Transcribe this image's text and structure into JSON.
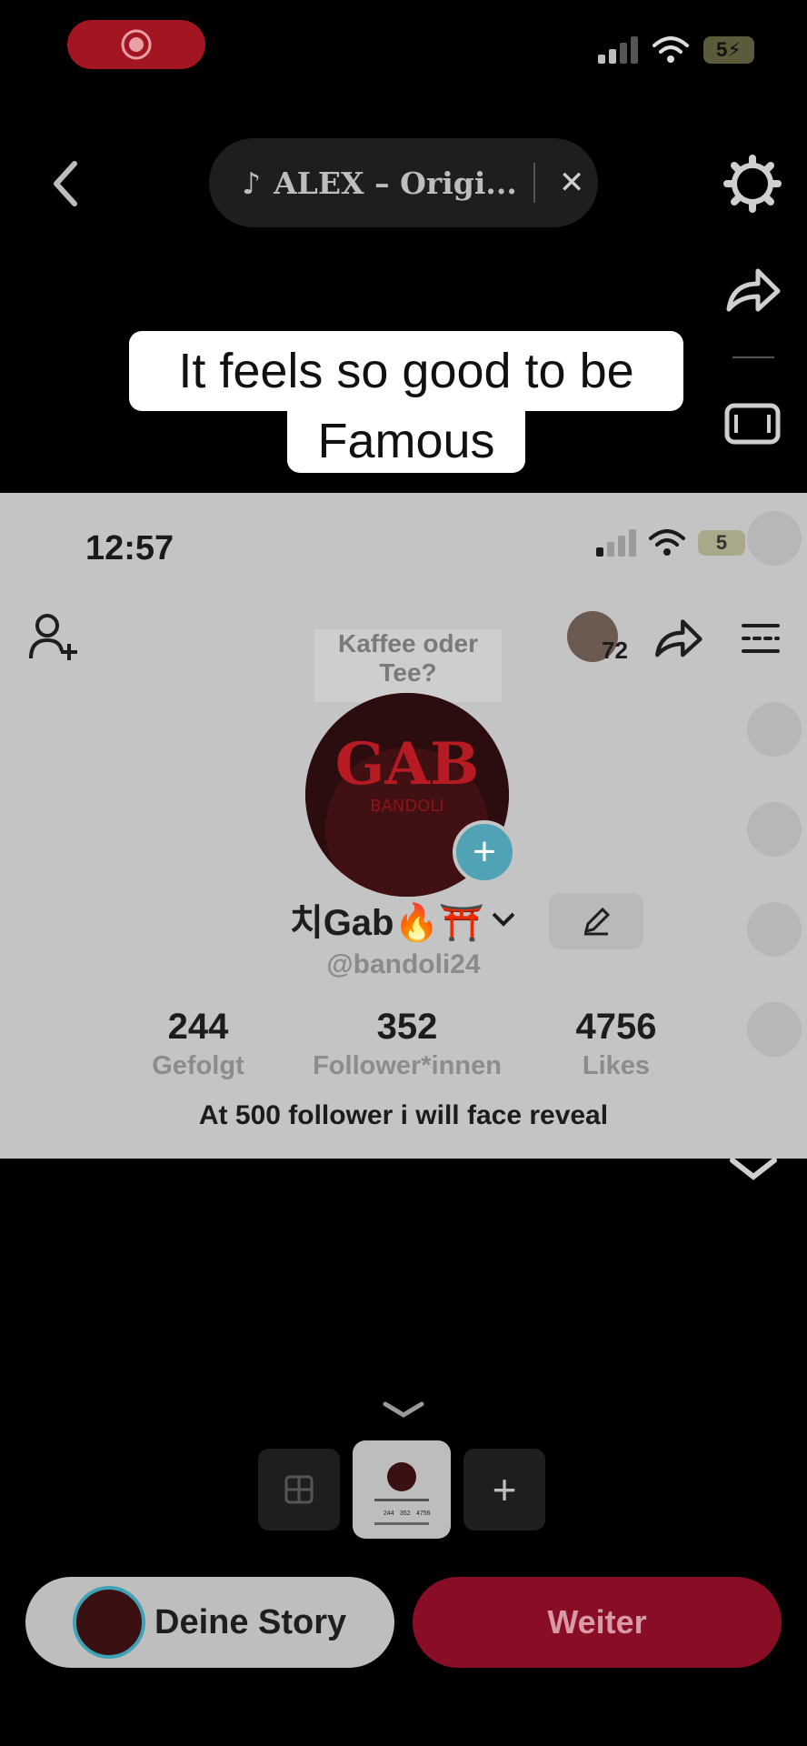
{
  "system_status": {
    "battery": "5",
    "icons": [
      "screen-record-icon",
      "signal-icon",
      "wifi-icon",
      "battery-icon"
    ]
  },
  "top_bar": {
    "sound_label": "ALEX – Origi...",
    "icons": [
      "back-icon",
      "music-note-icon",
      "close-icon",
      "settings-icon",
      "share-icon",
      "aspect-icon"
    ]
  },
  "caption": {
    "line1": "It feels so good to be",
    "line2": "Famous"
  },
  "profile_screenshot": {
    "time": "12:57",
    "battery": "5",
    "popup": "Kaffee oder Tee?",
    "viewer_count": "72",
    "avatar_text": "GAB",
    "avatar_subtext": "BANDOLI",
    "name": "치Gab🔥⛩️",
    "handle": "@bandoli24",
    "stats": [
      {
        "value": "244",
        "label": "Gefolgt"
      },
      {
        "value": "352",
        "label": "Follower*innen"
      },
      {
        "value": "4756",
        "label": "Likes"
      }
    ],
    "bio": "At 500 follower i will face reveal",
    "thumb_stats": [
      "244",
      "352",
      "4756"
    ]
  },
  "bottom": {
    "story_label": "Deine Story",
    "next_label": "Weiter"
  },
  "colors": {
    "record_red": "#a31621",
    "next_button": "#8a0d26",
    "teal_accent": "#4fa3b5"
  }
}
